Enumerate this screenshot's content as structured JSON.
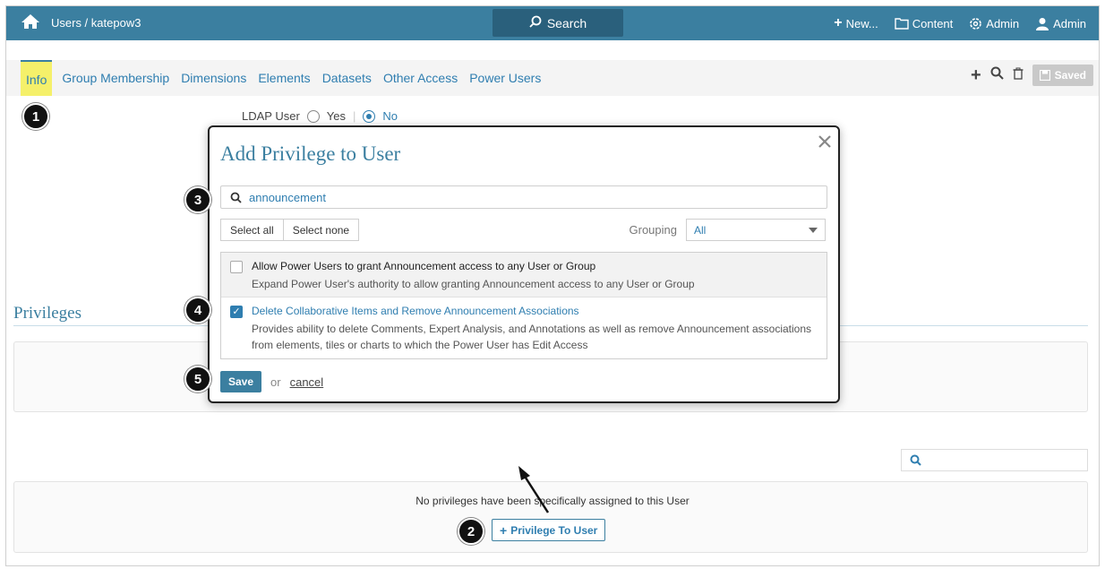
{
  "topbar": {
    "breadcrumb": "Users / katepow3",
    "search_label": "Search",
    "new_label": "New...",
    "content_label": "Content",
    "admin_label": "Admin",
    "user_label": "Admin"
  },
  "tabs": [
    "Info",
    "Group Membership",
    "Dimensions",
    "Elements",
    "Datasets",
    "Other Access",
    "Power Users"
  ],
  "toolbar": {
    "saved_label": "Saved"
  },
  "ldap": {
    "label": "LDAP User",
    "yes": "Yes",
    "no": "No",
    "selected": "No"
  },
  "privileges": {
    "title": "Privileges",
    "empty_text": "No privileges have been specifically assigned to this User",
    "add_button": "Privilege To User"
  },
  "modal": {
    "title": "Add Privilege to User",
    "search_value": "announcement",
    "select_all": "Select all",
    "select_none": "Select none",
    "grouping_label": "Grouping",
    "grouping_value": "All",
    "items": [
      {
        "title": "Allow Power Users to grant Announcement access to any User or Group",
        "description": "Expand Power User's authority to allow granting Announcement access to any User or Group",
        "checked": false
      },
      {
        "title": "Delete Collaborative Items and Remove Announcement Associations",
        "description": "Provides ability to delete Comments, Expert Analysis, and Annotations as well as remove Announcement associations from elements, tiles or charts to which the Power User has Edit Access",
        "checked": true
      }
    ],
    "save_label": "Save",
    "or_label": "or",
    "cancel_label": "cancel"
  },
  "callouts": [
    "1",
    "2",
    "3",
    "4",
    "5"
  ],
  "colors": {
    "brand": "#3b7fa0",
    "link": "#2f7eb0",
    "highlight": "#f5f06a"
  }
}
